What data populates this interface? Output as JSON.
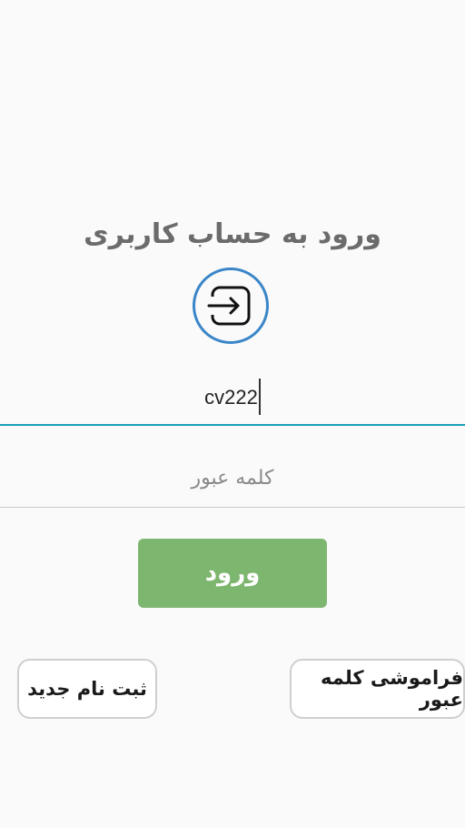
{
  "header": {
    "title": "ورود به حساب کاربری"
  },
  "icon": {
    "name": "login-icon",
    "color": "#3a86c8"
  },
  "form": {
    "username": {
      "value": "cv222"
    },
    "password": {
      "placeholder": "کلمه عبور"
    }
  },
  "actions": {
    "login_label": "ورود",
    "register_label": "ثبت نام جدید",
    "forgot_label": "فراموشی کلمه عبور"
  },
  "colors": {
    "accent_line": "#1aa0b8",
    "login_button": "#7db66e",
    "icon_circle": "#3a86c8"
  }
}
